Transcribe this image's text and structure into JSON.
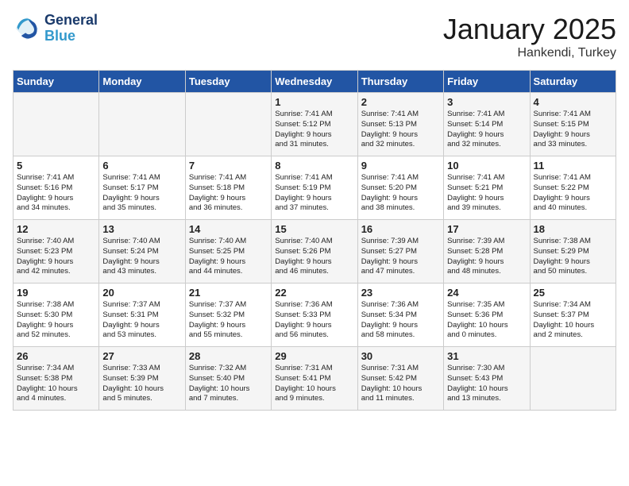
{
  "header": {
    "logo_line1": "General",
    "logo_line2": "Blue",
    "title": "January 2025",
    "subtitle": "Hankendi, Turkey"
  },
  "weekdays": [
    "Sunday",
    "Monday",
    "Tuesday",
    "Wednesday",
    "Thursday",
    "Friday",
    "Saturday"
  ],
  "weeks": [
    [
      {
        "day": "",
        "text": ""
      },
      {
        "day": "",
        "text": ""
      },
      {
        "day": "",
        "text": ""
      },
      {
        "day": "1",
        "text": "Sunrise: 7:41 AM\nSunset: 5:12 PM\nDaylight: 9 hours\nand 31 minutes."
      },
      {
        "day": "2",
        "text": "Sunrise: 7:41 AM\nSunset: 5:13 PM\nDaylight: 9 hours\nand 32 minutes."
      },
      {
        "day": "3",
        "text": "Sunrise: 7:41 AM\nSunset: 5:14 PM\nDaylight: 9 hours\nand 32 minutes."
      },
      {
        "day": "4",
        "text": "Sunrise: 7:41 AM\nSunset: 5:15 PM\nDaylight: 9 hours\nand 33 minutes."
      }
    ],
    [
      {
        "day": "5",
        "text": "Sunrise: 7:41 AM\nSunset: 5:16 PM\nDaylight: 9 hours\nand 34 minutes."
      },
      {
        "day": "6",
        "text": "Sunrise: 7:41 AM\nSunset: 5:17 PM\nDaylight: 9 hours\nand 35 minutes."
      },
      {
        "day": "7",
        "text": "Sunrise: 7:41 AM\nSunset: 5:18 PM\nDaylight: 9 hours\nand 36 minutes."
      },
      {
        "day": "8",
        "text": "Sunrise: 7:41 AM\nSunset: 5:19 PM\nDaylight: 9 hours\nand 37 minutes."
      },
      {
        "day": "9",
        "text": "Sunrise: 7:41 AM\nSunset: 5:20 PM\nDaylight: 9 hours\nand 38 minutes."
      },
      {
        "day": "10",
        "text": "Sunrise: 7:41 AM\nSunset: 5:21 PM\nDaylight: 9 hours\nand 39 minutes."
      },
      {
        "day": "11",
        "text": "Sunrise: 7:41 AM\nSunset: 5:22 PM\nDaylight: 9 hours\nand 40 minutes."
      }
    ],
    [
      {
        "day": "12",
        "text": "Sunrise: 7:40 AM\nSunset: 5:23 PM\nDaylight: 9 hours\nand 42 minutes."
      },
      {
        "day": "13",
        "text": "Sunrise: 7:40 AM\nSunset: 5:24 PM\nDaylight: 9 hours\nand 43 minutes."
      },
      {
        "day": "14",
        "text": "Sunrise: 7:40 AM\nSunset: 5:25 PM\nDaylight: 9 hours\nand 44 minutes."
      },
      {
        "day": "15",
        "text": "Sunrise: 7:40 AM\nSunset: 5:26 PM\nDaylight: 9 hours\nand 46 minutes."
      },
      {
        "day": "16",
        "text": "Sunrise: 7:39 AM\nSunset: 5:27 PM\nDaylight: 9 hours\nand 47 minutes."
      },
      {
        "day": "17",
        "text": "Sunrise: 7:39 AM\nSunset: 5:28 PM\nDaylight: 9 hours\nand 48 minutes."
      },
      {
        "day": "18",
        "text": "Sunrise: 7:38 AM\nSunset: 5:29 PM\nDaylight: 9 hours\nand 50 minutes."
      }
    ],
    [
      {
        "day": "19",
        "text": "Sunrise: 7:38 AM\nSunset: 5:30 PM\nDaylight: 9 hours\nand 52 minutes."
      },
      {
        "day": "20",
        "text": "Sunrise: 7:37 AM\nSunset: 5:31 PM\nDaylight: 9 hours\nand 53 minutes."
      },
      {
        "day": "21",
        "text": "Sunrise: 7:37 AM\nSunset: 5:32 PM\nDaylight: 9 hours\nand 55 minutes."
      },
      {
        "day": "22",
        "text": "Sunrise: 7:36 AM\nSunset: 5:33 PM\nDaylight: 9 hours\nand 56 minutes."
      },
      {
        "day": "23",
        "text": "Sunrise: 7:36 AM\nSunset: 5:34 PM\nDaylight: 9 hours\nand 58 minutes."
      },
      {
        "day": "24",
        "text": "Sunrise: 7:35 AM\nSunset: 5:36 PM\nDaylight: 10 hours\nand 0 minutes."
      },
      {
        "day": "25",
        "text": "Sunrise: 7:34 AM\nSunset: 5:37 PM\nDaylight: 10 hours\nand 2 minutes."
      }
    ],
    [
      {
        "day": "26",
        "text": "Sunrise: 7:34 AM\nSunset: 5:38 PM\nDaylight: 10 hours\nand 4 minutes."
      },
      {
        "day": "27",
        "text": "Sunrise: 7:33 AM\nSunset: 5:39 PM\nDaylight: 10 hours\nand 5 minutes."
      },
      {
        "day": "28",
        "text": "Sunrise: 7:32 AM\nSunset: 5:40 PM\nDaylight: 10 hours\nand 7 minutes."
      },
      {
        "day": "29",
        "text": "Sunrise: 7:31 AM\nSunset: 5:41 PM\nDaylight: 10 hours\nand 9 minutes."
      },
      {
        "day": "30",
        "text": "Sunrise: 7:31 AM\nSunset: 5:42 PM\nDaylight: 10 hours\nand 11 minutes."
      },
      {
        "day": "31",
        "text": "Sunrise: 7:30 AM\nSunset: 5:43 PM\nDaylight: 10 hours\nand 13 minutes."
      },
      {
        "day": "",
        "text": ""
      }
    ]
  ]
}
